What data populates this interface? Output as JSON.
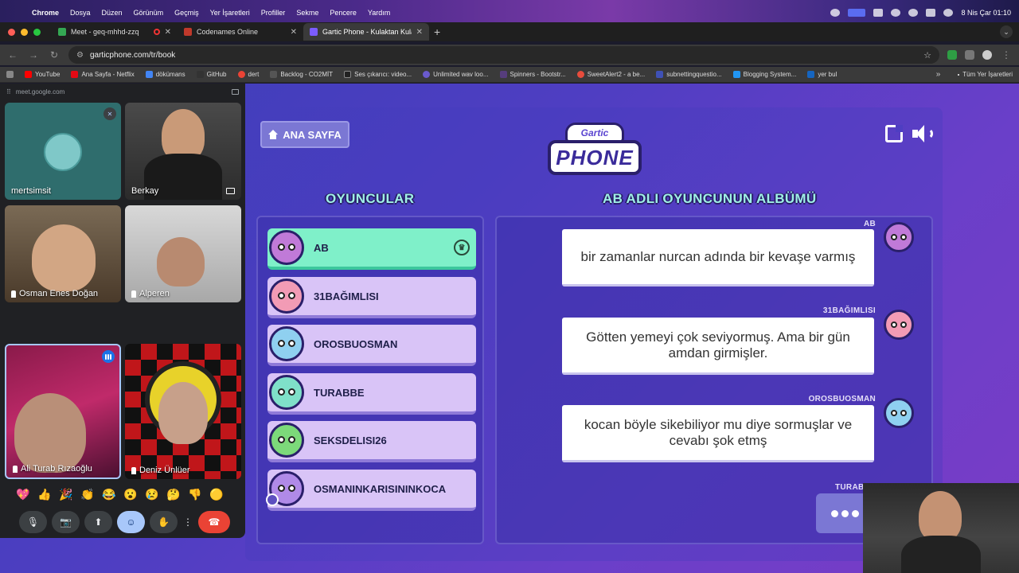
{
  "menubar": {
    "items": [
      "Chrome",
      "Dosya",
      "Düzen",
      "Görünüm",
      "Geçmiş",
      "Yer İşaretleri",
      "Profiller",
      "Sekme",
      "Pencere",
      "Yardım"
    ],
    "clock": "8 Nis Çar  01:10"
  },
  "tabs": [
    {
      "title": "Meet - geq-mhhd-zzq",
      "favicon_color": "#34a853",
      "active": false,
      "recording": true
    },
    {
      "title": "Codenames Online",
      "favicon_color": "#c0392b",
      "active": false,
      "recording": false
    },
    {
      "title": "Gartic Phone - Kulaktan Kula",
      "favicon_color": "#7b5cff",
      "active": true,
      "recording": false
    }
  ],
  "address": {
    "url": "garticphone.com/tr/book"
  },
  "bookmarks": {
    "items": [
      {
        "label": "YouTube",
        "color": "#ff0000"
      },
      {
        "label": "Ana Sayfa - Netflix",
        "color": "#e50914"
      },
      {
        "label": "dökümans",
        "color": "#4285f4"
      },
      {
        "label": "GitHub",
        "color": "#333333"
      },
      {
        "label": "dert",
        "color": "#ea4335"
      },
      {
        "label": "Backlog - CO2MİT",
        "color": "#555555"
      },
      {
        "label": "Ses çıkarıcı: video...",
        "color": "#222222"
      },
      {
        "label": "Unlimited wav loo...",
        "color": "#6a5acd"
      },
      {
        "label": "Spinners - Bootstr...",
        "color": "#563d7c"
      },
      {
        "label": "SweetAlert2 - a be...",
        "color": "#e74c3c"
      },
      {
        "label": "subnettingquestio...",
        "color": "#3f51b5"
      },
      {
        "label": "Blogging System...",
        "color": "#2196f3"
      },
      {
        "label": "yer bul",
        "color": "#1565c0"
      }
    ],
    "all_label": "Tüm Yer İşaretleri"
  },
  "meet": {
    "url": "meet.google.com",
    "participants": [
      {
        "name": "mertsimsit"
      },
      {
        "name": "Berkay"
      },
      {
        "name": "Osman Enes Doğan"
      },
      {
        "name": "Alperen"
      },
      {
        "name": "Ali Turab Rızaoğlu"
      },
      {
        "name": "Deniz Ünlüer"
      }
    ],
    "reactions": [
      "💖",
      "👍",
      "🎉",
      "👏",
      "😂",
      "😮",
      "😢",
      "🤔",
      "👎",
      "🟡"
    ],
    "controls": {
      "mic": "🎙",
      "camera": "📷",
      "present": "⬆",
      "emoji": "☺",
      "hand": "✋",
      "more": "⋮",
      "hangup": "☎"
    }
  },
  "game": {
    "home_label": "ANA SAYFA",
    "logo_top": "Gartic",
    "logo_main": "PHONE",
    "players_title": "OYUNCULAR",
    "album_title": "AB ADLI OYUNCUNUN ALBÜMÜ",
    "players": [
      {
        "name": "AB",
        "avatar_color": "#c07ad8",
        "host": true
      },
      {
        "name": "31BAĞIMLISI",
        "avatar_color": "#f29bb5",
        "host": false
      },
      {
        "name": "OROSBUOSMAN",
        "avatar_color": "#8fd0f0",
        "host": false
      },
      {
        "name": "TURABBE",
        "avatar_color": "#7fe0c9",
        "host": false
      },
      {
        "name": "SEKSDELISI26",
        "avatar_color": "#7cd97a",
        "host": false
      },
      {
        "name": "OSMANINKARISININKOCA",
        "avatar_color": "#b08ae8",
        "host": false
      }
    ],
    "album": [
      {
        "author": "AB",
        "text": "bir zamanlar nurcan adında bir kevaşe varmış",
        "avatar_color": "#c07ad8"
      },
      {
        "author": "31BAĞIMLISI",
        "text": "Götten yemeyi çok seviyormuş. Ama bir gün amdan girmişler.",
        "avatar_color": "#f29bb5"
      },
      {
        "author": "OROSBUOSMAN",
        "text": "kocan böyle sikebiliyor mu diye sormuşlar ve cevabı şok etmş",
        "avatar_color": "#8fd0f0"
      },
      {
        "author": "TURABBE",
        "text": "",
        "avatar_color": "#7fe0c9"
      }
    ]
  }
}
